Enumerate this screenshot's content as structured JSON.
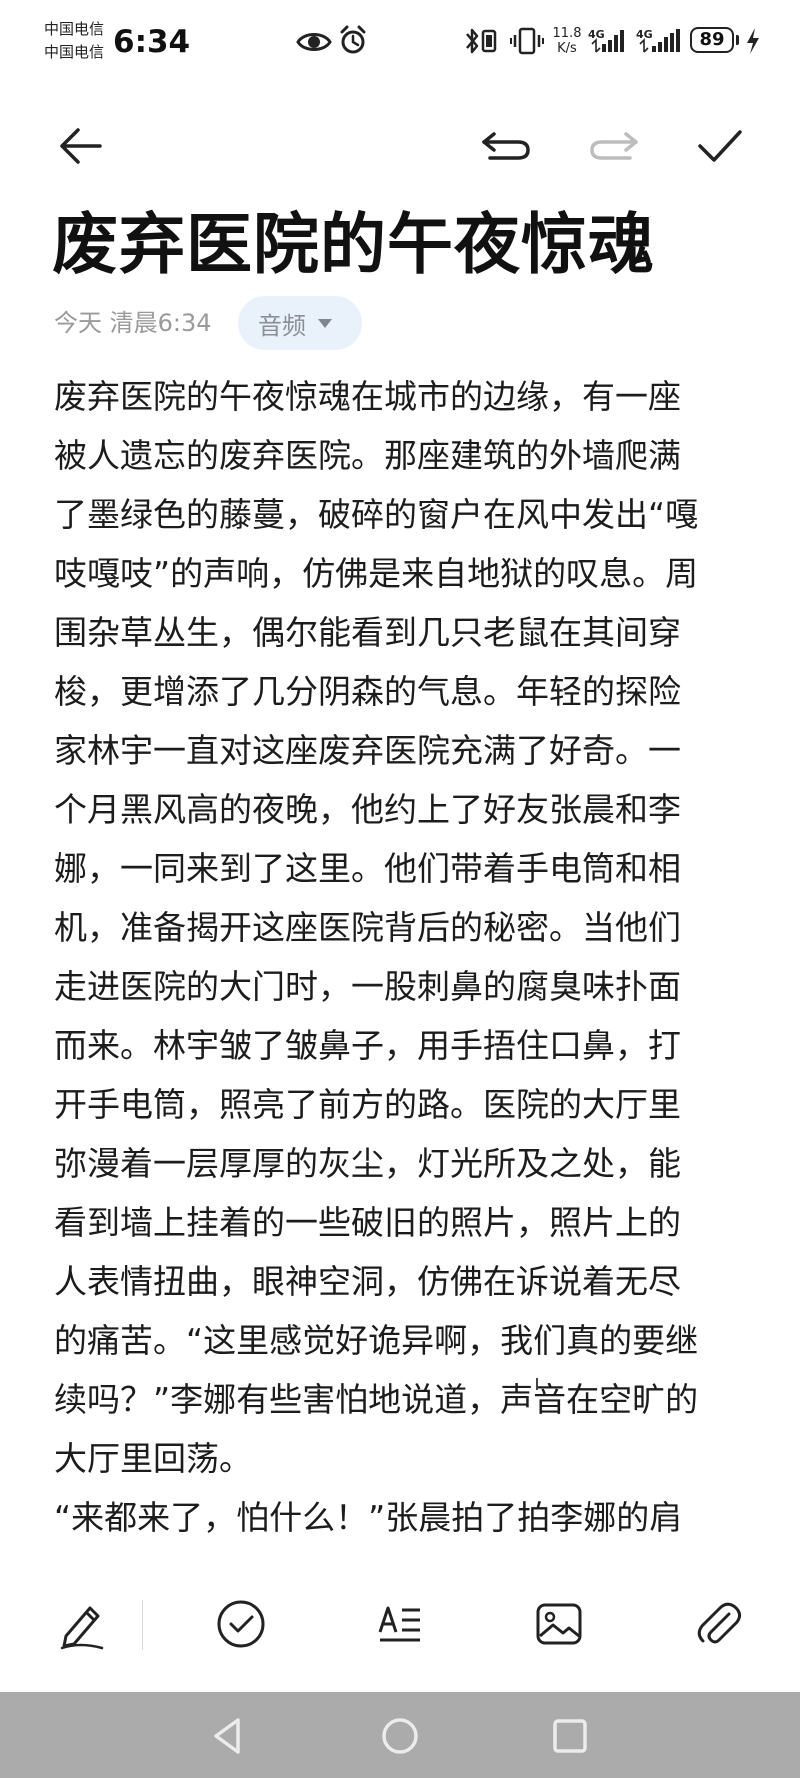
{
  "status_bar": {
    "carrier_1": "中国电信",
    "carrier_2": "中国电信",
    "time": "6:34",
    "net_speed_value": "11.8",
    "net_speed_unit": "K/s",
    "signal_1_label": "4G",
    "signal_2_label": "4G",
    "battery": "89",
    "icons": [
      "eye-comfort-icon",
      "alarm-icon",
      "bluetooth-icon",
      "vibrate-icon",
      "signal-icon",
      "charging-icon"
    ]
  },
  "toolbar": {
    "icons": [
      "back-arrow-icon",
      "undo-icon",
      "redo-icon",
      "checkmark-icon"
    ],
    "redo_enabled": false
  },
  "note": {
    "title": "废弃医院的午夜惊魂",
    "date": "今天 清晨6:34",
    "audio_chip_label": "音频",
    "lines": [
      "废弃医院的午夜惊魂在城市的边缘，有一座",
      "被人遗忘的废弃医院。那座建筑的外墙爬满",
      "了墨绿色的藤蔓，破碎的窗户在风中发出“嘎",
      "吱嘎吱”的声响，仿佛是来自地狱的叹息。周",
      "围杂草丛生，偶尔能看到几只老鼠在其间穿",
      "梭，更增添了几分阴森的气息。年轻的探险",
      "家林宇一直对这座废弃医院充满了好奇。一",
      "个月黑风高的夜晚，他约上了好友张晨和李",
      "娜，一同来到了这里。他们带着手电筒和相",
      "机，准备揭开这座医院背后的秘密。当他们",
      "走进医院的大门时，一股刺鼻的腐臭味扑面",
      "而来。林宇皱了皱鼻子，用手捂住口鼻，打",
      "开手电筒，照亮了前方的路。医院的大厅里",
      "弥漫着一层厚厚的灰尘，灯光所及之处，能",
      "看到墙上挂着的一些破旧的照片，照片上的",
      "人表情扭曲，眼神空洞，仿佛在诉说着无尽",
      "的痛苦。“这里感觉好诡异啊，我们真的要继",
      "续吗？”李娜有些害怕地说道，声音在空旷的",
      "大厅里回荡。",
      "“来都来了，怕什么！”张晨拍了拍李娜的肩"
    ]
  },
  "bottom_toolbar": {
    "icons": [
      "handwriting-pen-icon",
      "checklist-icon",
      "text-format-icon",
      "image-icon",
      "attachment-icon"
    ]
  },
  "nav_bar": {
    "icons": [
      "nav-back-icon",
      "nav-home-icon",
      "nav-recents-icon"
    ]
  }
}
